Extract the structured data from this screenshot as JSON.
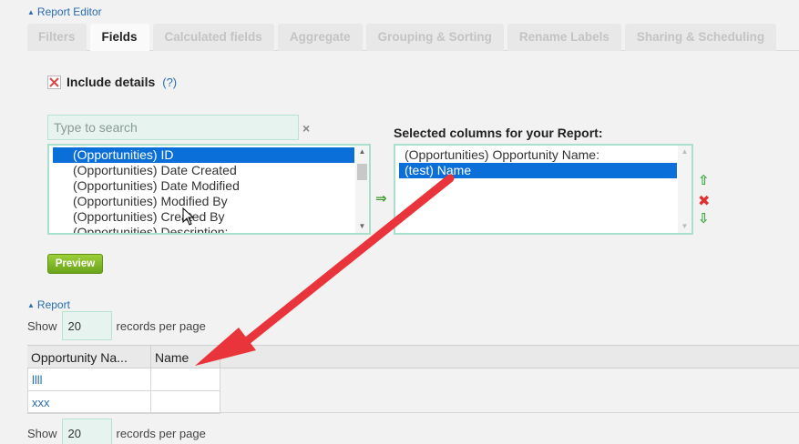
{
  "report_editor": {
    "toggle_label": "Report Editor"
  },
  "tabs": [
    {
      "label": "Filters"
    },
    {
      "label": "Fields"
    },
    {
      "label": "Calculated fields"
    },
    {
      "label": "Aggregate"
    },
    {
      "label": "Grouping & Sorting"
    },
    {
      "label": "Rename Labels"
    },
    {
      "label": "Sharing & Scheduling"
    }
  ],
  "fields": {
    "include_details_label": "Include details",
    "help_link": "(?)",
    "search_placeholder": "Type to search",
    "clear_symbol": "×",
    "available_columns": [
      "(Opportunities) ID",
      "(Opportunities) Date Created",
      "(Opportunities) Date Modified",
      "(Opportunities) Modified By",
      "(Opportunities) Created By",
      "(Opportunities) Description:"
    ],
    "selected_title": "Selected columns for your Report:",
    "selected_columns": [
      "(Opportunities) Opportunity Name:",
      "(test) Name"
    ],
    "move_arrow_symbol": "⇒",
    "up_symbol": "⇧",
    "remove_symbol": "✖",
    "down_symbol": "⇩",
    "preview_label": "Preview"
  },
  "report": {
    "toggle_label": "Report",
    "show_label": "Show",
    "records_per_page_value": "20",
    "records_per_page_label": "records per page",
    "columns": [
      "Opportunity Na...",
      "Name"
    ],
    "rows": [
      {
        "opportunity_name": "llll",
        "name": ""
      },
      {
        "opportunity_name": "xxx",
        "name": ""
      }
    ]
  },
  "colors": {
    "accent_blue": "#2a6cb0",
    "selection_blue": "#0a6fd9",
    "annotation_red": "#e8343a",
    "preview_green": "#7ab828"
  },
  "icons": {
    "collapse": "triangle-up-icon",
    "checkbox": "checkbox-x-icon",
    "cursor": "mouse-pointer-icon"
  }
}
